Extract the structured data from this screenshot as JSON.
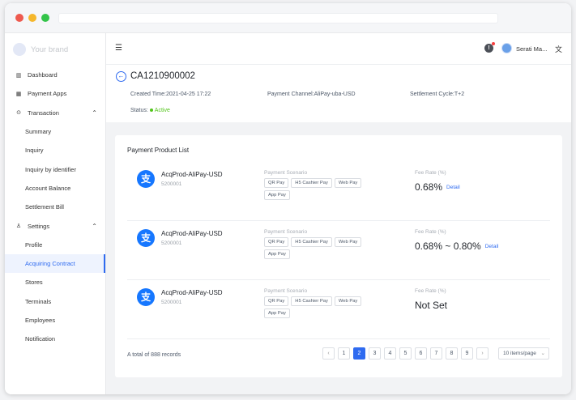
{
  "brand": {
    "name": "Your brand"
  },
  "sidebar": {
    "items": [
      {
        "label": "Dashboard",
        "icon": "bar-chart-icon",
        "type": "top"
      },
      {
        "label": "Payment Apps",
        "icon": "grid-icon",
        "type": "top"
      },
      {
        "label": "Transaction",
        "icon": "transaction-icon",
        "type": "group",
        "expanded": true
      },
      {
        "label": "Summary",
        "type": "sub"
      },
      {
        "label": "Inquiry",
        "type": "sub"
      },
      {
        "label": "Inquiry by identifier",
        "type": "sub"
      },
      {
        "label": "Account Balance",
        "type": "sub"
      },
      {
        "label": "Settlement Bill",
        "type": "sub"
      },
      {
        "label": "Settings",
        "icon": "user-icon",
        "type": "group",
        "expanded": true
      },
      {
        "label": "Profile",
        "type": "sub"
      },
      {
        "label": "Acquiring Contract",
        "type": "sub",
        "active": true
      },
      {
        "label": "Stores",
        "type": "sub"
      },
      {
        "label": "Terminals",
        "type": "sub"
      },
      {
        "label": "Employees",
        "type": "sub"
      },
      {
        "label": "Notification",
        "type": "sub"
      }
    ]
  },
  "topbar": {
    "user_name": "Serati Ma...",
    "notification_icon": "!",
    "lang_icon": "translate-icon"
  },
  "contract": {
    "id": "CA1210900002",
    "created_label": "Created Time:",
    "created_value": "2021-04-25 17:22",
    "channel_label": "Payment Channel:",
    "channel_value": "AliPay-uba-USD",
    "cycle_label": "Settlement Cycle:",
    "cycle_value": "T+2",
    "status_label": "Status:",
    "status_value": "Active"
  },
  "product_list": {
    "title": "Payment Product List",
    "scenario_label": "Payment Scenario",
    "fee_label": "Fee Rate (%)",
    "detail_label": "Detail",
    "items": [
      {
        "name": "AcqProd-AliPay-USD",
        "code": "5200001",
        "scenarios": [
          "QR Pay",
          "H5 Cashier Pay",
          "Web Pay",
          "App Pay"
        ],
        "fee": "0.68%",
        "has_detail": true
      },
      {
        "name": "AcqProd-AliPay-USD",
        "code": "5200001",
        "scenarios": [
          "QR Pay",
          "H5 Cashier Pay",
          "Web Pay",
          "App Pay"
        ],
        "fee": "0.68% ~ 0.80%",
        "has_detail": true
      },
      {
        "name": "AcqProd-AliPay-USD",
        "code": "5200001",
        "scenarios": [
          "QR Pay",
          "H5 Cashier Pay",
          "Web Pay",
          "App Pay"
        ],
        "fee": "Not Set",
        "has_detail": false
      }
    ]
  },
  "pagination": {
    "total_text": "A total of 888 records",
    "prev": "‹",
    "next": "›",
    "pages": [
      "1",
      "2",
      "3",
      "4",
      "5",
      "6",
      "7",
      "8",
      "9"
    ],
    "current": "2",
    "page_size": "10 items/page"
  },
  "colors": {
    "accent": "#2f6bf0",
    "active": "#52c41a",
    "alipay": "#1677ff"
  }
}
